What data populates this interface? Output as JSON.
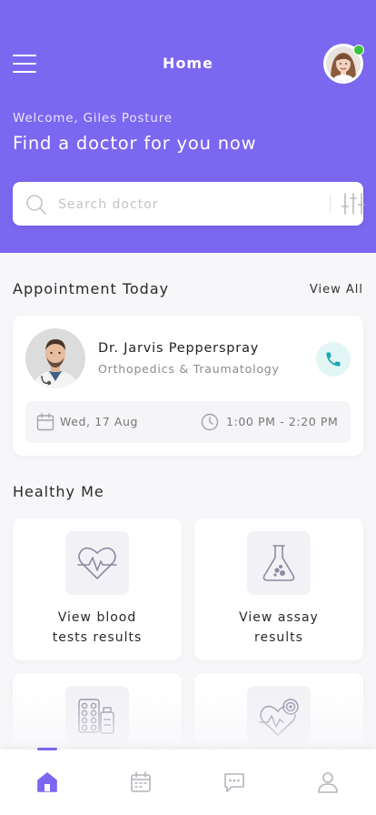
{
  "colors": {
    "brand": "#7b67f0",
    "accent_teal": "#1aa8b8",
    "online": "#3cc23c"
  },
  "header": {
    "title": "Home",
    "welcome": "Welcome, Giles Posture",
    "headline": "Find a doctor for you now",
    "menu_icon": "hamburger-menu-icon",
    "avatar_status": "online"
  },
  "search": {
    "placeholder": "Search doctor",
    "value": "",
    "icon": "search-icon",
    "filter_icon": "sliders-filter-icon"
  },
  "appointments": {
    "title": "Appointment Today",
    "view_all": "View All",
    "card": {
      "doctor_name": "Dr. Jarvis Pepperspray",
      "specialty": "Orthopedics & Traumatology",
      "date": "Wed, 17 Aug",
      "time": "1:00 PM - 2:20 PM",
      "call_icon": "phone-icon"
    }
  },
  "healthy_me": {
    "title": "Healthy Me",
    "tiles": [
      {
        "label": "View blood\ntests results",
        "icon": "heart-pulse-icon"
      },
      {
        "label": "View assay\nresults",
        "icon": "lab-flask-icon"
      },
      {
        "label": "",
        "icon": "pills-medication-icon"
      },
      {
        "label": "",
        "icon": "heart-monitor-icon"
      }
    ]
  },
  "bottom_nav": {
    "active": 0,
    "items": [
      {
        "icon": "home-icon"
      },
      {
        "icon": "calendar-icon"
      },
      {
        "icon": "chat-icon"
      },
      {
        "icon": "profile-icon"
      }
    ]
  }
}
